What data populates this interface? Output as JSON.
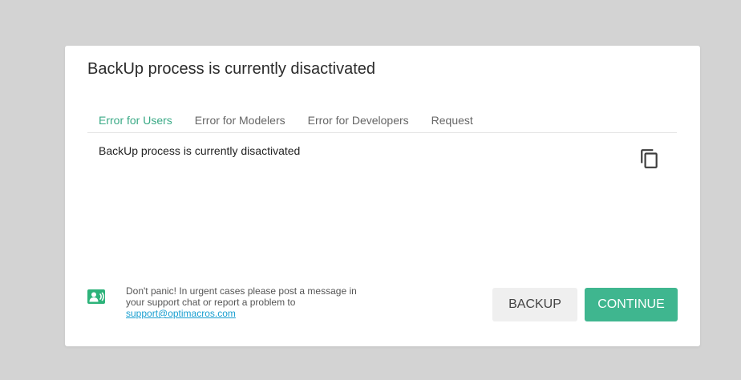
{
  "dialog": {
    "title": "BackUp process is currently disactivated",
    "tabs": [
      {
        "label": "Error for Users",
        "active": true
      },
      {
        "label": "Error for Modelers",
        "active": false
      },
      {
        "label": "Error for Developers",
        "active": false
      },
      {
        "label": "Request",
        "active": false
      }
    ],
    "message": "BackUp process is currently disactivated",
    "copy_icon": "copy-icon",
    "footer": {
      "icon": "support-contact-icon",
      "text_before": "Don't panic! In urgent cases please post a message in your support chat or report a problem to ",
      "link": "support@optimacros.com"
    },
    "buttons": {
      "backup": "BACKUP",
      "continue": "CONTINUE"
    }
  },
  "colors": {
    "accent": "#3fb68f",
    "active_tab": "#3aaa86",
    "link": "#1a9fd0",
    "overlay": "#d3d3d3"
  }
}
